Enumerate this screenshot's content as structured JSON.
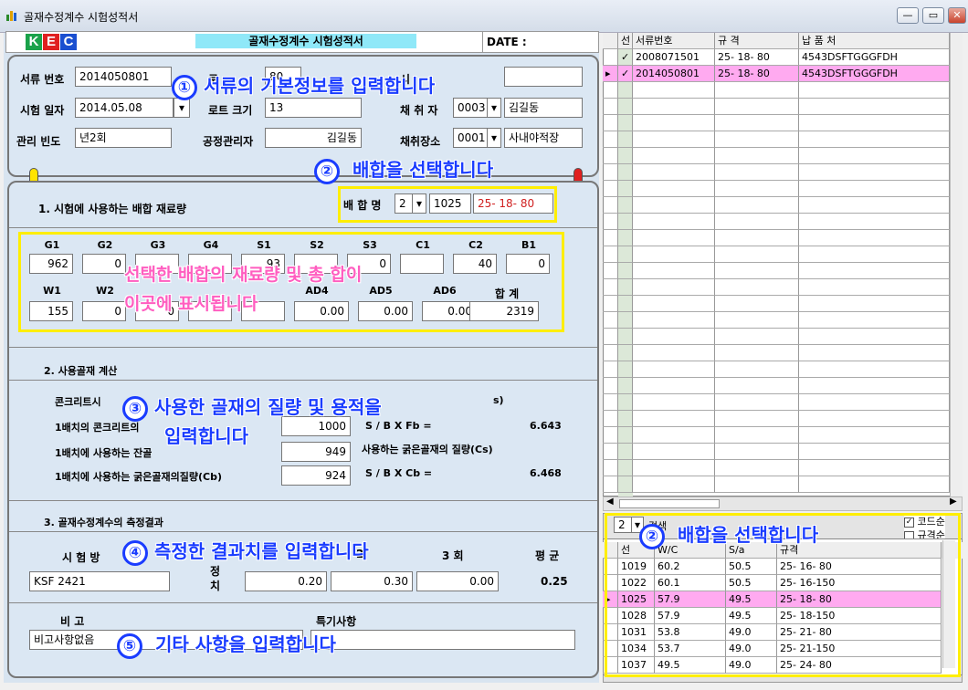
{
  "window": {
    "title": "골재수정계수 시험성적서"
  },
  "header": {
    "logo": [
      "K",
      "E",
      "C"
    ],
    "form_title": "골재수정계수 시험성적서",
    "date": "DATE : 2014.05.08"
  },
  "basic": {
    "doc_no_label": "서류 번호",
    "doc_no": "2014050801",
    "lot_label": "로",
    "lot_partial": "80",
    "test_date_label": "시험 일자",
    "test_date": "2014.05.08",
    "lot_size_label": "로트 크기",
    "lot_size": "13",
    "sampler_label": "채 취 자",
    "sampler_code": "0003",
    "sampler_name": "김길동",
    "mgmt_label": "관리 빈도",
    "mgmt": "년2회",
    "process_mgr_label": "공정관리자",
    "process_mgr": "김길동",
    "place_label": "채취장소",
    "place_code": "0001",
    "place_name": "사내야적장",
    "misc_label_partial": "시"
  },
  "mix": {
    "section_title": "1. 시험에 사용하는 배합 재료량",
    "mix_name_label": "배 합 명",
    "mix_sel": "2",
    "mix_code": "1025",
    "mix_spec": "25- 18- 80",
    "row1": [
      {
        "l": "G1",
        "v": "962"
      },
      {
        "l": "G2",
        "v": "0"
      },
      {
        "l": "G3",
        "v": ""
      },
      {
        "l": "G4",
        "v": ""
      },
      {
        "l": "S1",
        "v": "93"
      },
      {
        "l": "S2",
        "v": ""
      },
      {
        "l": "S3",
        "v": "0"
      },
      {
        "l": "C1",
        "v": ""
      },
      {
        "l": "C2",
        "v": "40"
      },
      {
        "l": "B1",
        "v": "0"
      }
    ],
    "row2": [
      {
        "l": "W1",
        "v": "155"
      },
      {
        "l": "W2",
        "v": "0"
      },
      {
        "l": "",
        "v": "0"
      },
      {
        "l": "",
        "v": ""
      },
      {
        "l": "",
        "v": ""
      },
      {
        "l": "AD4",
        "v": "0.00"
      },
      {
        "l": "AD5",
        "v": "0.00"
      },
      {
        "l": "AD6",
        "v": "0.00"
      }
    ],
    "total_label": "합 계",
    "total": "2319"
  },
  "calc": {
    "section_title": "2. 사용골재 계산",
    "concrete_label": "콘크리트시",
    "line1_label": "1배치의 콘크리트의 ",
    "line1_value": "1000",
    "line2_label": "1배치에 사용하는 잔골",
    "line2_value": "949",
    "line3_label": "1배치에 사용하는 굵은골재의질량(Cb)",
    "line3_value": "924",
    "right_s_partial": "s)",
    "right1_formula": "S / B X Fb =",
    "right1_value": "6.643",
    "right2_label": "사용하는 굵은골재의 질량(Cs)",
    "right3_formula": "S / B X Cb =",
    "right3_value": "6.468"
  },
  "result": {
    "section_title": "3. 골재수정계수의 측정결과",
    "method_label": "시 험 방",
    "method": "KSF 2421",
    "col_label_partial": "정\n치",
    "col2": "2",
    "col3": "3 회",
    "avg_label": "평 균",
    "v1": "0.20",
    "v2": "0.30",
    "v3": "0.00",
    "avg": "0.25"
  },
  "remark": {
    "label": "비 고",
    "value": "비고사항없음",
    "special_label": "특기사항"
  },
  "callouts": {
    "c1": "서류의 기본정보를 입력합니다",
    "c2": "배합을 선택합니다",
    "c3a": "사용한 골재의 질량 및 용적을",
    "c3b": "입력합니다",
    "c4": "측정한 결과치를 입력합니다",
    "c5": "기타 사항을 입력합니다",
    "c2b": "배합을 선택합니다",
    "pink1": "선택한 배합의 재료량 및 총 합이",
    "pink2": "이곳에 표시됩니다",
    "n1": "①",
    "n2": "②",
    "n3": "③",
    "n4": "④",
    "n5": "⑤",
    "n2b": "②"
  },
  "top_grid": {
    "headers": [
      "선",
      "서류번호",
      "규 격",
      "납 품 처"
    ],
    "rows": [
      {
        "check": "✓",
        "doc": "2008071501",
        "spec": "25- 18- 80",
        "client": "4543DSFTGGGFDH"
      },
      {
        "check": "✓",
        "doc": "2014050801",
        "spec": "25- 18- 80",
        "client": "4543DSFTGGGFDH"
      }
    ]
  },
  "bottom_grid": {
    "combo": "2",
    "search_partial": "검색",
    "opt1": "코드순",
    "opt2": "규격순",
    "headers": [
      "선",
      "W/C",
      "S/a",
      "규격"
    ],
    "rows": [
      {
        "code": "1019",
        "wc": "60.2",
        "sa": "50.5",
        "spec": "25- 16- 80"
      },
      {
        "code": "1022",
        "wc": "60.1",
        "sa": "50.5",
        "spec": "25- 16-150"
      },
      {
        "code": "1025",
        "wc": "57.9",
        "sa": "49.5",
        "spec": "25- 18- 80"
      },
      {
        "code": "1028",
        "wc": "57.9",
        "sa": "49.5",
        "spec": "25- 18-150"
      },
      {
        "code": "1031",
        "wc": "53.8",
        "sa": "49.0",
        "spec": "25- 21- 80"
      },
      {
        "code": "1034",
        "wc": "53.7",
        "sa": "49.0",
        "spec": "25- 21-150"
      },
      {
        "code": "1037",
        "wc": "49.5",
        "sa": "49.0",
        "spec": "25- 24- 80"
      }
    ]
  }
}
